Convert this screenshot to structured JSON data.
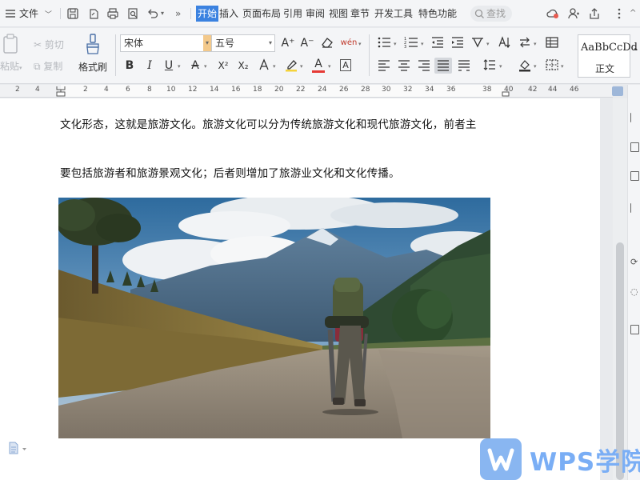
{
  "menubar": {
    "file_label": "文件",
    "tabs": [
      {
        "label": "开始",
        "active": true
      },
      {
        "label": "插入"
      },
      {
        "label": "页面布局"
      },
      {
        "label": "引用"
      },
      {
        "label": "审阅"
      },
      {
        "label": "视图"
      },
      {
        "label": "章节"
      },
      {
        "label": "开发工具"
      },
      {
        "label": "特色功能"
      }
    ],
    "search_placeholder": "查找",
    "accent_color": "#3b82e0"
  },
  "ribbon": {
    "paste_label": "粘贴",
    "cut_label": "剪切",
    "copy_label": "复制",
    "format_painter_label": "格式刷",
    "font_name": "宋体",
    "font_size": "五号",
    "style_sample": "AaBbCcDd",
    "style_name": "正文",
    "bold": "B",
    "italic": "I",
    "underline": "U",
    "strike": "A",
    "superscript": "X²",
    "subscript": "X₂",
    "font_color_letter": "A",
    "char_border_letter": "A",
    "grow_font": "A⁺",
    "shrink_font": "A⁻",
    "phonetic": "wén"
  },
  "ruler": {
    "ticks": [
      "4",
      "2",
      "2",
      "4",
      "6",
      "8",
      "10",
      "12",
      "14",
      "16",
      "18",
      "20",
      "22",
      "24",
      "26",
      "28",
      "30",
      "32",
      "34",
      "36",
      "38",
      "40",
      "42",
      "44",
      "46"
    ]
  },
  "document": {
    "line1": "文化形态，这就是旅游文化。旅游文化可以分为传统旅游文化和现代旅游文化，前者主",
    "line2": "要包括旅游者和旅游景观文化；后者则增加了旅游业文化和文化传播。",
    "image_alt": "hiker-on-mountain-road-photo"
  },
  "watermark": {
    "brand": "WPS学院"
  }
}
